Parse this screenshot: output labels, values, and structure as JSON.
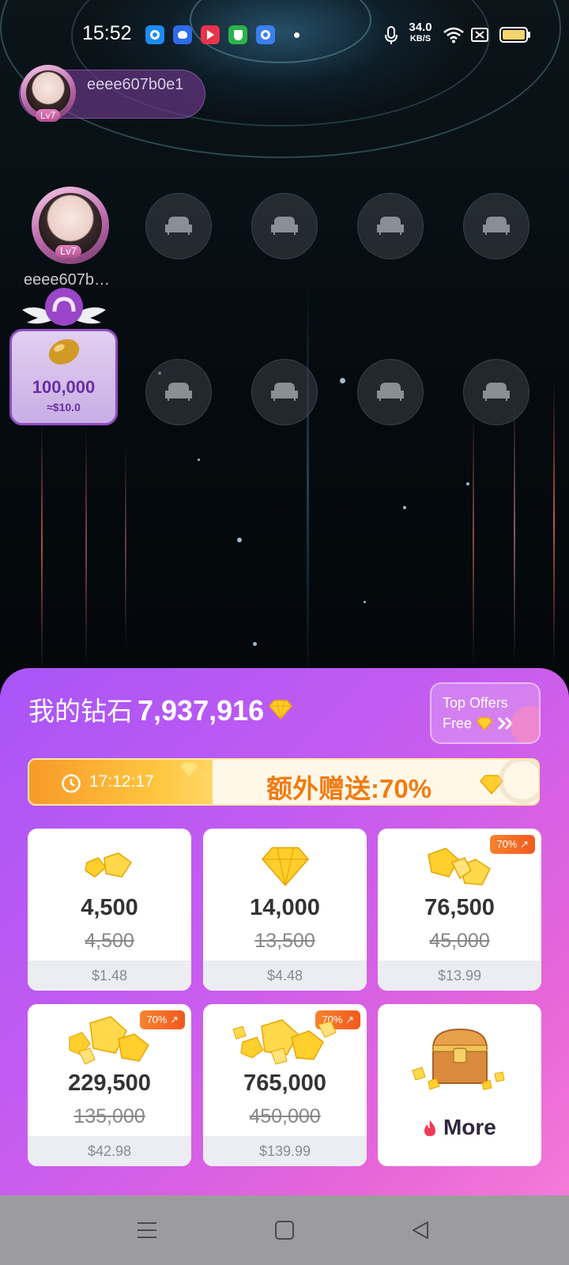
{
  "status_bar": {
    "time": "15:52",
    "net_speed_value": "34.0",
    "net_speed_unit": "KB/S",
    "icons": [
      "mic-icon",
      "wifi-icon",
      "sim-off-icon",
      "battery-icon"
    ],
    "app_icons": [
      "blue-circle-app-icon",
      "baidu-app-icon",
      "red-play-app-icon",
      "green-shield-app-icon",
      "blue-q-app-icon"
    ]
  },
  "host": {
    "name": "eeee607b0e1",
    "level": "Lv7"
  },
  "seats": {
    "owner_name": "eeee607b…",
    "owner_level": "Lv7"
  },
  "gift": {
    "amount": "100,000",
    "usd": "≈$10.0"
  },
  "wallet": {
    "label": "我的钻石",
    "balance": "7,937,916"
  },
  "top_offers": {
    "line1": "Top Offers",
    "line2": "Free"
  },
  "promo": {
    "countdown": "17:12:17",
    "text": "额外赠送:70%"
  },
  "packages": [
    {
      "amount": "4,500",
      "old": "4,500",
      "price": "$1.48",
      "badge": ""
    },
    {
      "amount": "14,000",
      "old": "13,500",
      "price": "$4.48",
      "badge": ""
    },
    {
      "amount": "76,500",
      "old": "45,000",
      "price": "$13.99",
      "badge": "70%"
    },
    {
      "amount": "229,500",
      "old": "135,000",
      "price": "$42.98",
      "badge": "70%"
    },
    {
      "amount": "765,000",
      "old": "450,000",
      "price": "$139.99",
      "badge": "70%"
    }
  ],
  "more": {
    "label": "More"
  },
  "colors": {
    "sheet_start": "#a855f7",
    "sheet_end": "#f47ad8",
    "promo_orange": "#f07b12",
    "badge": "#f25a1e"
  }
}
